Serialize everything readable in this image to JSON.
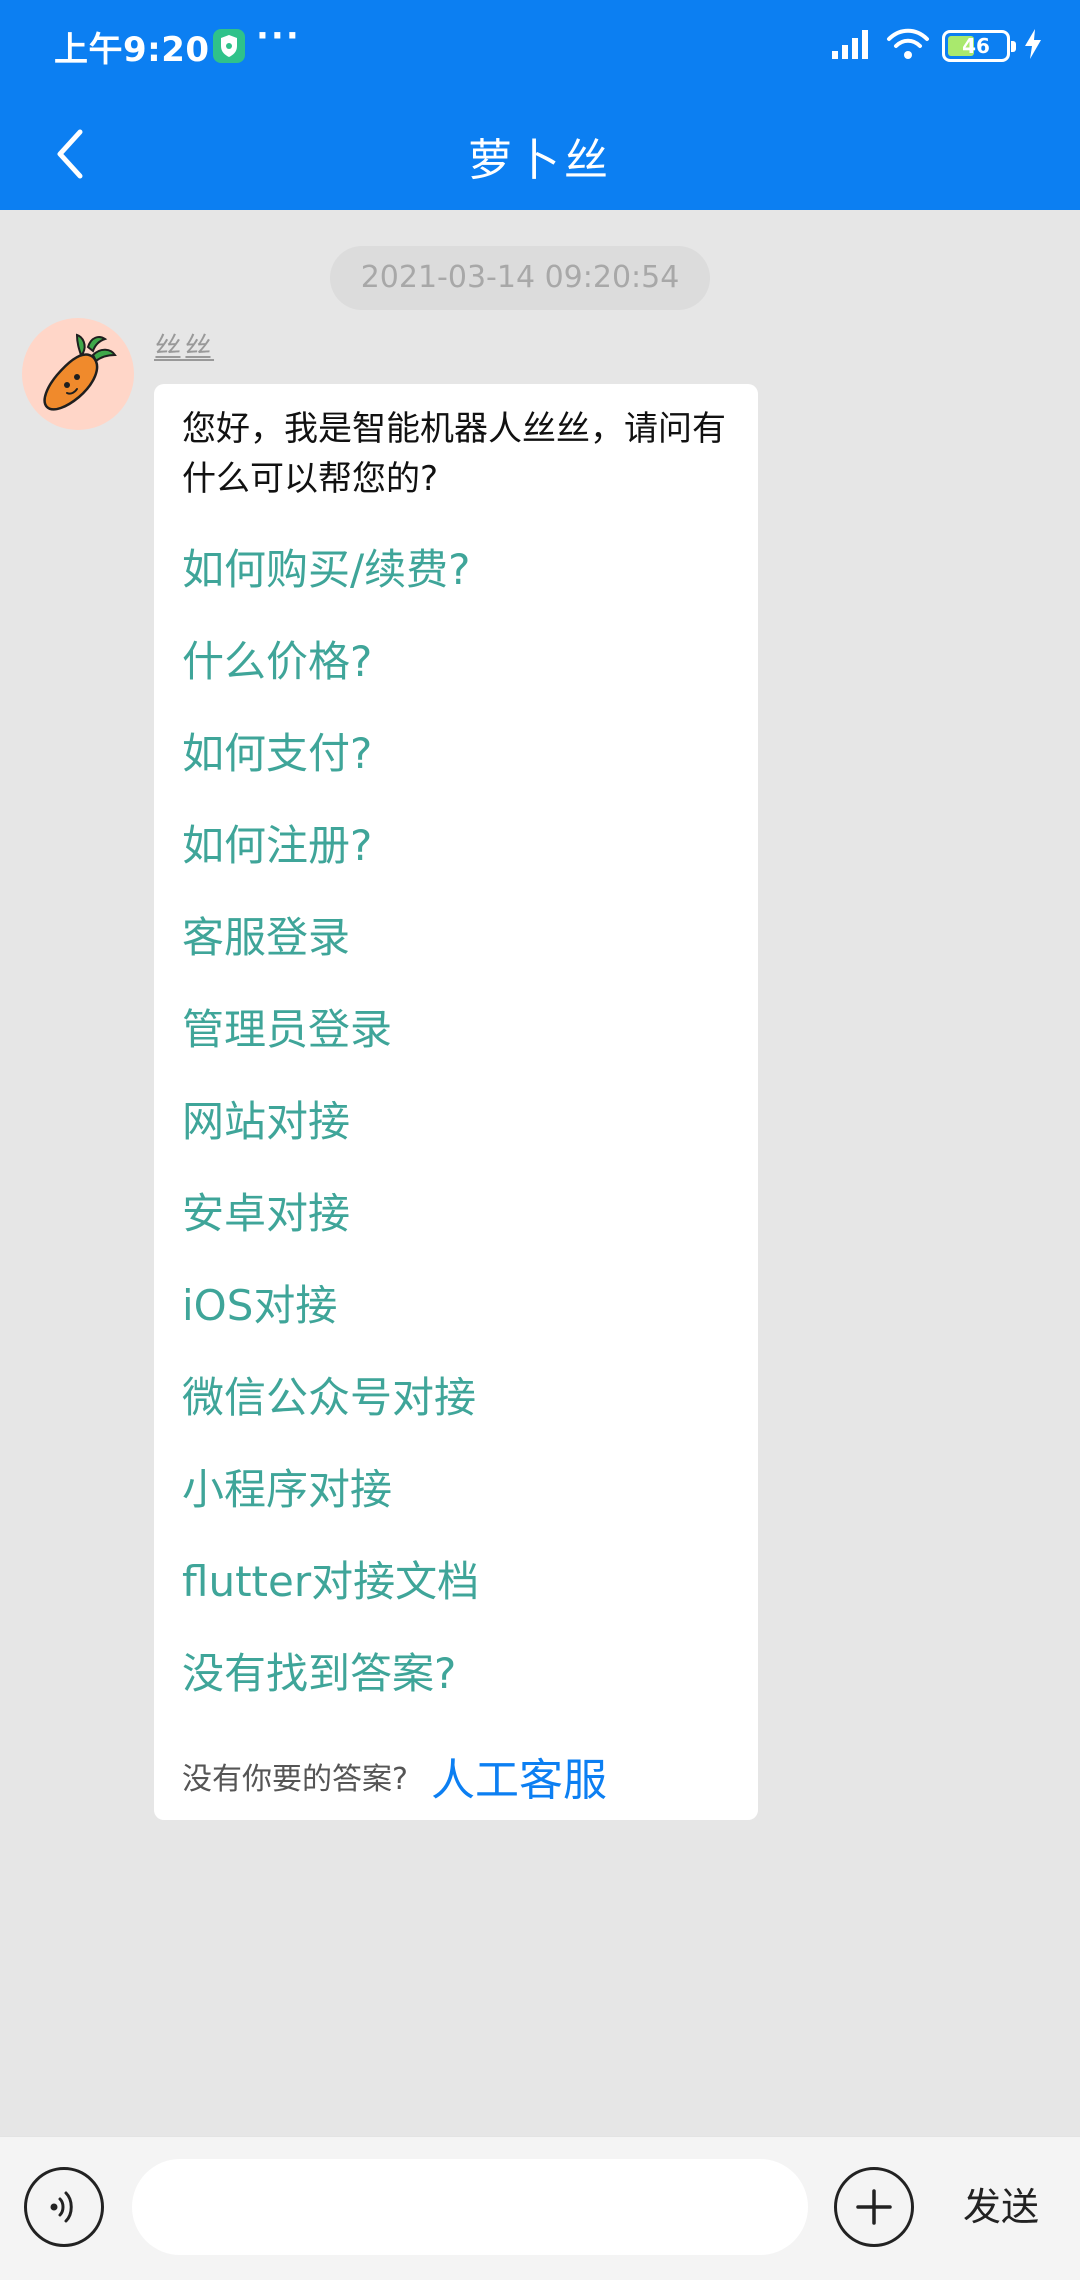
{
  "status_bar": {
    "time": "上午9:20",
    "more": "···",
    "battery": "46",
    "battery_level": 0.46
  },
  "nav": {
    "title": "萝卜丝"
  },
  "chat": {
    "timestamp": "2021-03-14 09:20:54",
    "sender": "丝丝",
    "greeting": "您好，我是智能机器人丝丝，请问有什么可以帮您的?",
    "options": [
      "如何购买/续费?",
      "什么价格?",
      "如何支付?",
      "如何注册?",
      "客服登录",
      "管理员登录",
      "网站对接",
      "安卓对接",
      "iOS对接",
      "微信公众号对接",
      "小程序对接",
      "flutter对接文档",
      "没有找到答案?"
    ],
    "footer_hint": "没有你要的答案?",
    "human_agent": "人工客服"
  },
  "composer": {
    "placeholder": "",
    "send_label": "发送"
  },
  "colors": {
    "header": "#0c7ff2",
    "option_text": "#3fa599",
    "agent_link": "#0c7ff2",
    "background": "#e6e6e6"
  },
  "icons": {
    "shield": "shield-icon",
    "signal": "signal-icon",
    "wifi": "wifi-icon",
    "battery": "battery-icon",
    "charging": "charging-icon",
    "back": "chevron-left-icon",
    "avatar": "carrot-icon",
    "voice": "voice-icon",
    "plus": "plus-icon"
  }
}
